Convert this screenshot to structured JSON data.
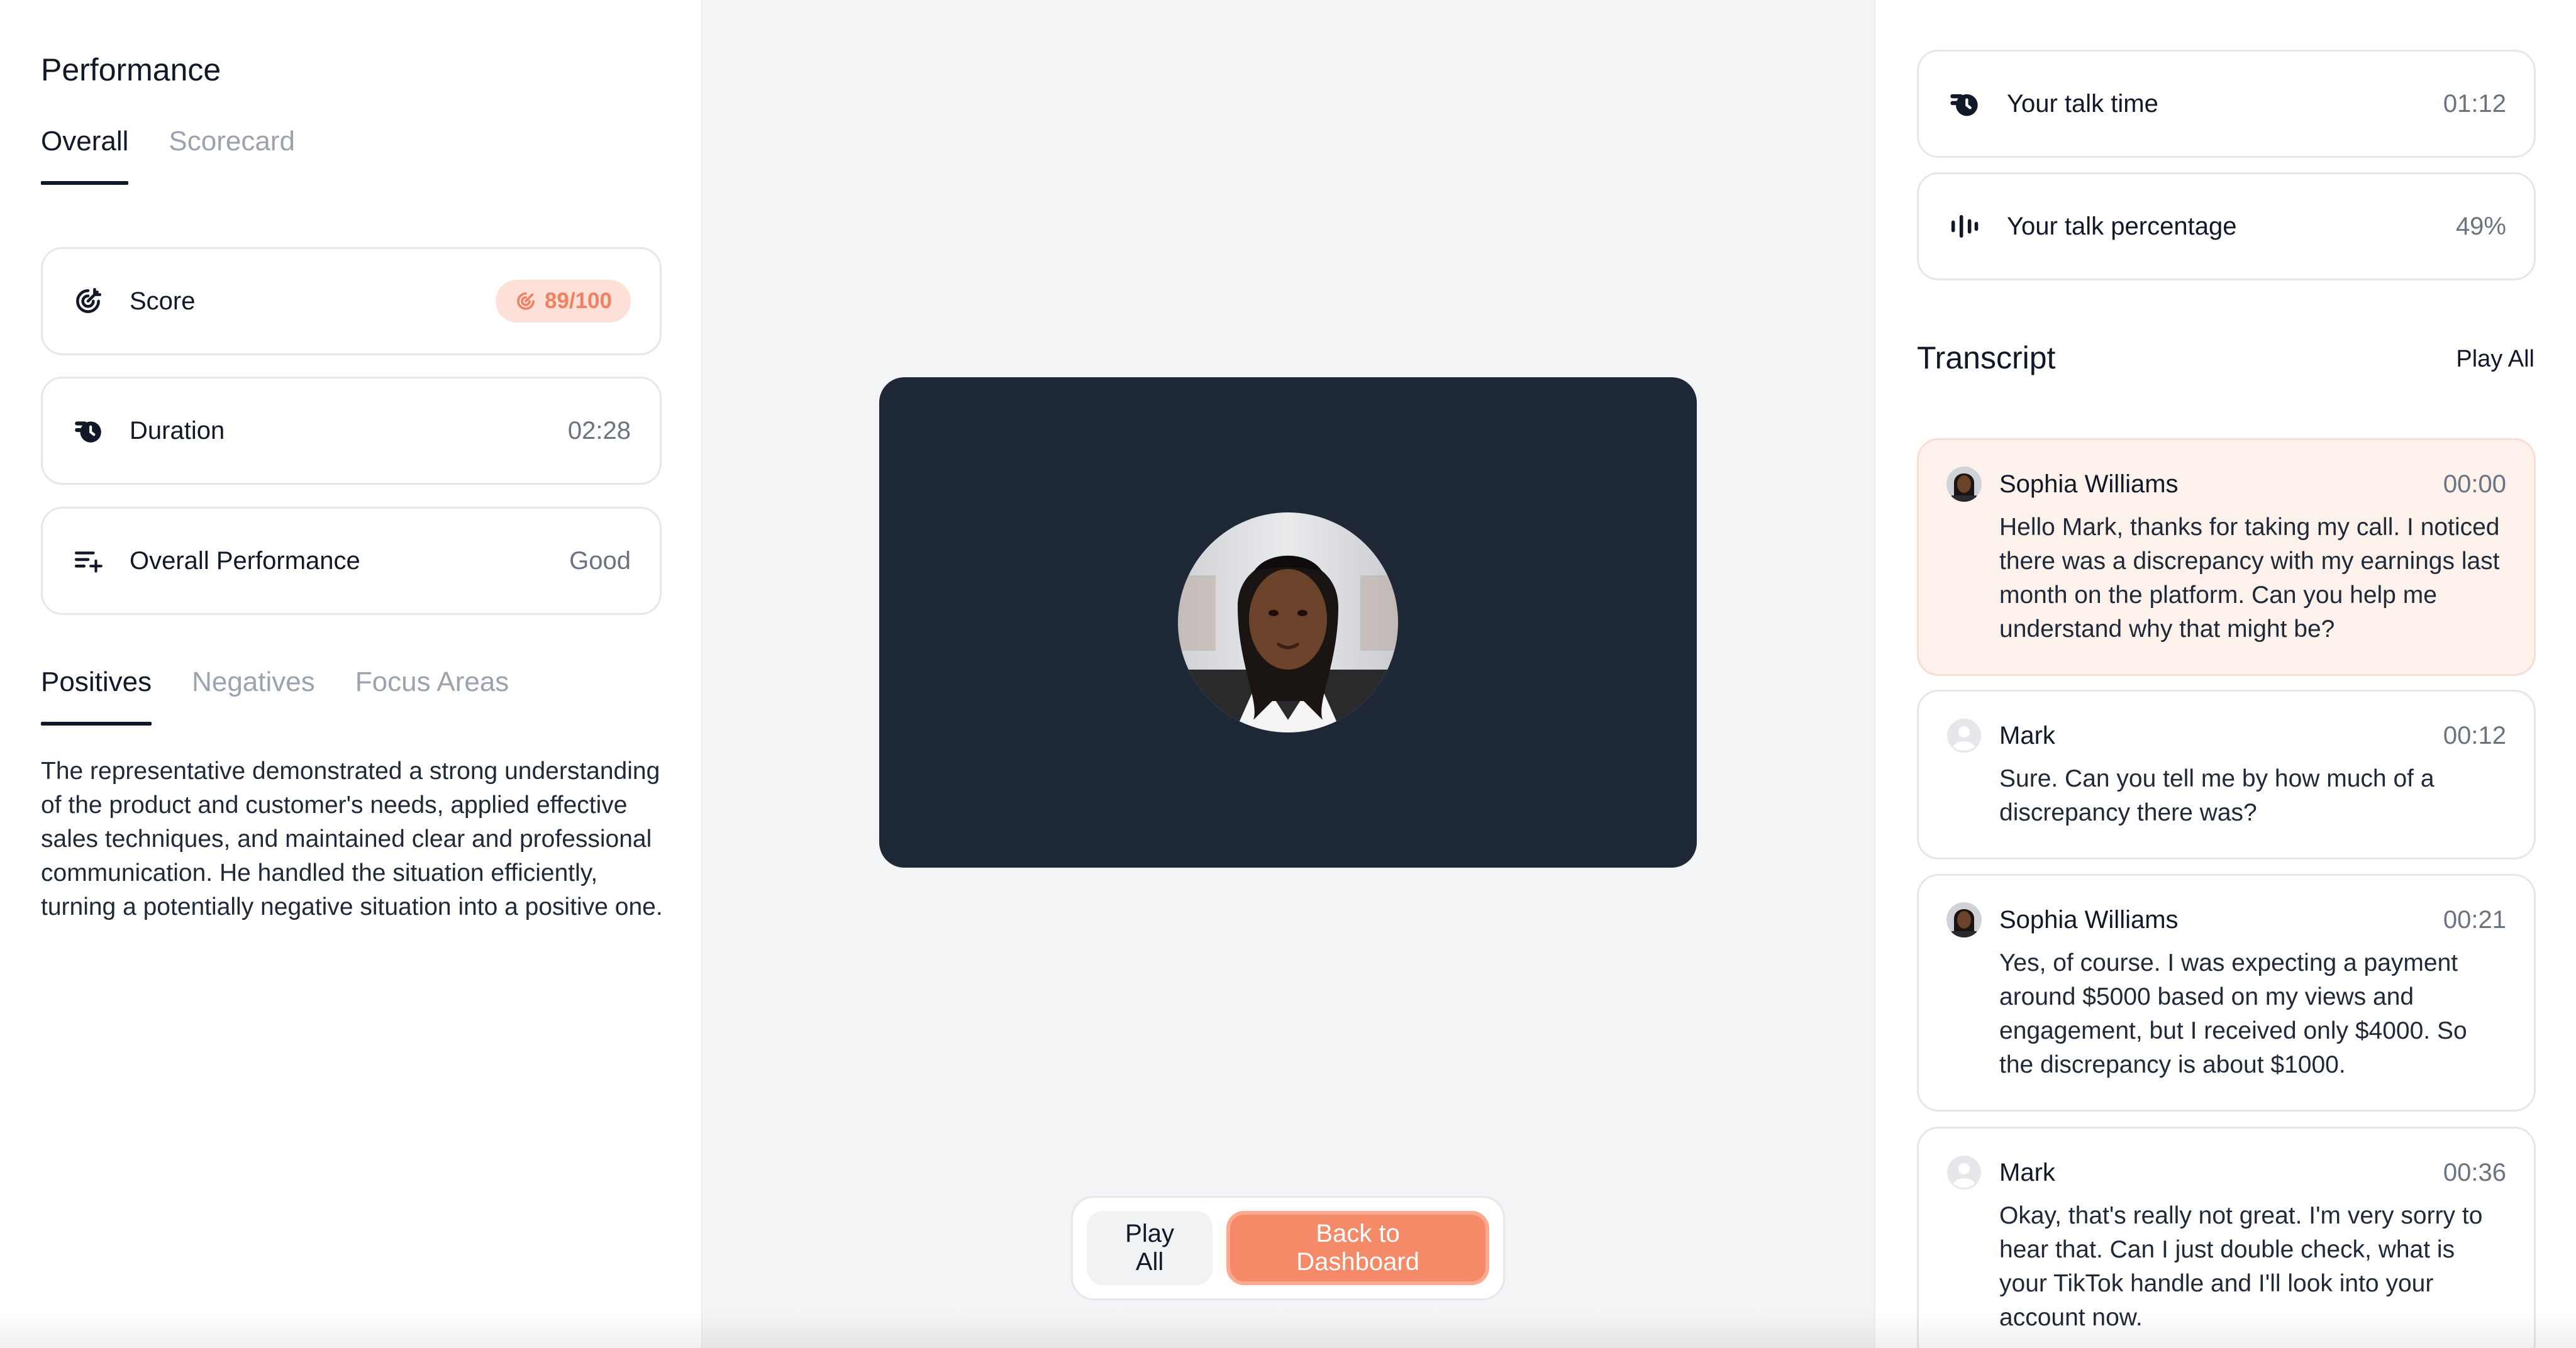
{
  "performance": {
    "title": "Performance",
    "tabs": [
      {
        "label": "Overall",
        "active": true
      },
      {
        "label": "Scorecard",
        "active": false
      }
    ],
    "stats": {
      "score": {
        "label": "Score",
        "value": "89/100",
        "icon": "target-icon"
      },
      "duration": {
        "label": "Duration",
        "value": "02:28",
        "icon": "clock-icon"
      },
      "overall": {
        "label": "Overall Performance",
        "value": "Good",
        "icon": "sparkle-list-icon"
      }
    },
    "feedback_tabs": [
      {
        "label": "Positives",
        "active": true
      },
      {
        "label": "Negatives",
        "active": false
      },
      {
        "label": "Focus Areas",
        "active": false
      }
    ],
    "summary": "The representative demonstrated a strong understanding of the product and customer's needs, applied effective sales techniques, and maintained clear and professional communication. He handled the situation efficiently, turning a potentially negative situation into a positive one."
  },
  "player": {
    "play_all": "Play All",
    "back": "Back to Dashboard"
  },
  "metrics": {
    "talk_time": {
      "label": "Your talk time",
      "value": "01:12",
      "icon": "clock-icon"
    },
    "talk_percentage": {
      "label": "Your talk percentage",
      "value": "49%",
      "icon": "audio-bars-icon"
    }
  },
  "transcript": {
    "title": "Transcript",
    "play_all": "Play All",
    "messages": [
      {
        "speaker": "Sophia Williams",
        "time": "00:00",
        "text": "Hello Mark, thanks for taking my call. I noticed there was a discrepancy with my earnings last month on the platform. Can you help me understand why that might be?"
      },
      {
        "speaker": "Mark",
        "time": "00:12",
        "text": "Sure. Can you tell me by how much of a discrepancy there was?"
      },
      {
        "speaker": "Sophia Williams",
        "time": "00:21",
        "text": "Yes, of course. I was expecting a payment around $5000 based on my views and engagement, but I received only $4000. So the discrepancy is about $1000."
      },
      {
        "speaker": "Mark",
        "time": "00:36",
        "text": "Okay, that's really not great. I'm very sorry to hear that. Can I just double check, what is your TikTok handle and I'll look into your account now."
      }
    ]
  },
  "colors": {
    "accent": "#f48a68",
    "badge_bg": "#fde1d9",
    "video_bg": "#1e2836",
    "highlight_bg": "#fdf1ec"
  }
}
